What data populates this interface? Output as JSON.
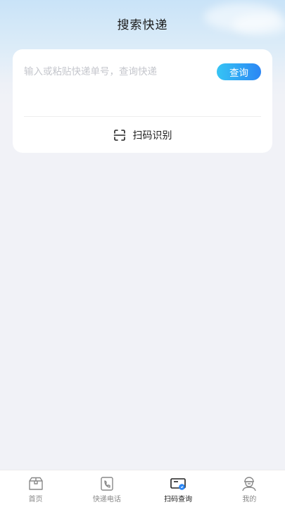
{
  "header": {
    "title": "搜索快递"
  },
  "search": {
    "placeholder": "输入或粘贴快递单号，查询快递",
    "value": "",
    "button_label": "查询"
  },
  "scan": {
    "label": "扫码识别",
    "icon": "scan-icon"
  },
  "tabbar": {
    "active_index": 2,
    "items": [
      {
        "label": "首页",
        "icon": "box-icon"
      },
      {
        "label": "快递电话",
        "icon": "phone-icon"
      },
      {
        "label": "扫码查询",
        "icon": "scan-box-icon"
      },
      {
        "label": "我的",
        "icon": "courier-avatar-icon"
      }
    ]
  },
  "colors": {
    "accent_start": "#36c4f4",
    "accent_end": "#2b86f4",
    "background": "#f1f2f7"
  }
}
